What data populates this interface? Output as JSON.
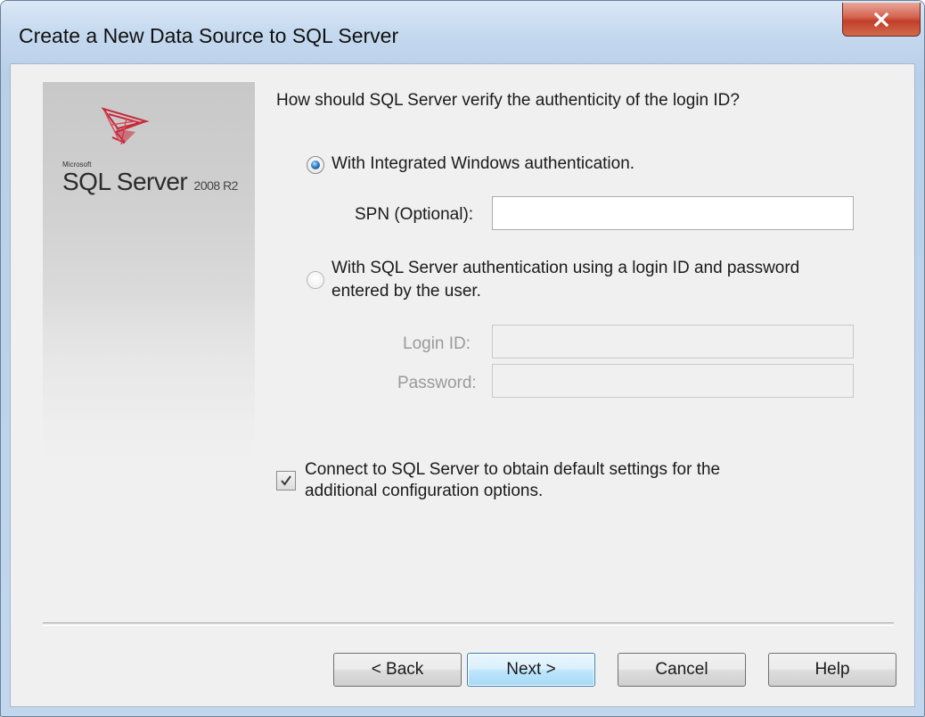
{
  "window": {
    "title": "Create a New Data Source to SQL Server",
    "close_glyph": "X"
  },
  "banner": {
    "logo_microsoft": "Microsoft",
    "logo_product": "SQL Server",
    "logo_version": "2008 R2",
    "logo_icon": "sql-server-logo-icon"
  },
  "auth": {
    "question": "How should SQL Server verify the authenticity of the login ID?",
    "windows_option": {
      "label": "With Integrated Windows authentication.",
      "selected": true
    },
    "spn": {
      "label": "SPN (Optional):",
      "value": ""
    },
    "sql_option": {
      "label_line1": "With SQL Server authentication using a login ID and password",
      "label_line2": "entered by the user.",
      "selected": false
    },
    "login_id": {
      "label": "Login ID:",
      "value": "",
      "enabled": false
    },
    "password": {
      "label": "Password:",
      "value": "",
      "enabled": false
    }
  },
  "connect_default": {
    "checked": true,
    "label_line1": "Connect to SQL Server to obtain default settings for the",
    "label_line2": "additional configuration options."
  },
  "buttons": {
    "back": "< Back",
    "next": "Next >",
    "cancel": "Cancel",
    "help": "Help"
  },
  "colors": {
    "title_bar": "#c5d9ef",
    "close_button": "#c23f29",
    "dialog_face": "#f0f0f0",
    "default_button": "#bee6fd",
    "logo_red": "#c8283a"
  }
}
